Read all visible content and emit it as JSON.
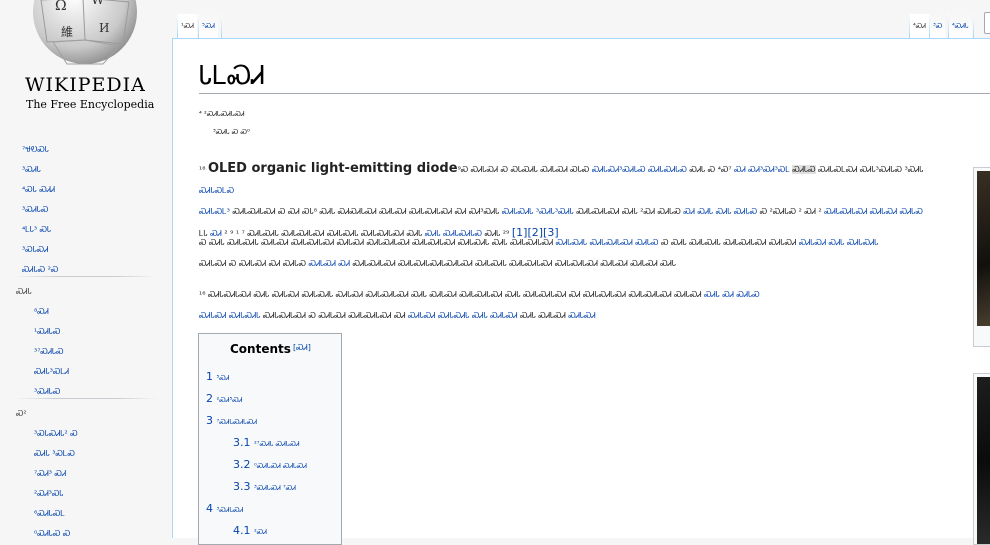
{
  "logo": {
    "wordmark": "WIKIPEDIA",
    "tagline": "The Free Encyclopedia",
    "globe_glyphs": [
      "Ω",
      "W",
      "維",
      "И"
    ]
  },
  "nav": {
    "main": [
      "⁷ᏠᎧᏍᏓ",
      "³ᏍᏗᏓ",
      "⁴ᏍᏓ ᏍᏗᏗ",
      "³ᏍᏗᏓᏍ",
      "⁴ᏞᏓ³ ᏍᏓ",
      "³ᏍᏓᏍᏗ",
      "ᏍᏗᏓᏍ ²Ꮝ"
    ],
    "interaction_heading": "ᏍᏗᏓ",
    "interaction": [
      "⁸ᏍᏗ",
      "¹ᏍᏗᏓᏍ",
      "³⁷ᏍᏗᏓᏍ",
      "ᏍᏗᏓ³ᏍᏞᏗ",
      "³ᏍᏗᏓᏍ"
    ],
    "tools_heading": "Ꮝ²",
    "tools": [
      "³ᏍᏓᏍᏗᏓ² Ꮝ",
      "ᏍᏗᏓ ³ᏍᏞᏍ",
      "⁷ᏍᏗ³ ᏍᏗ",
      "²ᏍᏗ³ᏍᏓ",
      "⁶ᏍᏗᏓᏍᏞ",
      "⁰ᏍᏗᏓᏍ Ꮝ"
    ]
  },
  "tabs": {
    "article": "¹ᏍᏗ",
    "talk": "⁵ᏍᏗ",
    "read": "⁴ᏍᏗ",
    "edit": "³Ꮝ",
    "history": "⁴ᏍᏗᏓ"
  },
  "article": {
    "title": "ᏓᏞᏍᏗ",
    "hatnote_1": "⁴ ²ᏍᏗᏓᏍᏗᏓᏍᏗ",
    "hatnote_2": "³ᏍᏗᏓ Ꮝ Ꮝ⁰",
    "para1": {
      "lead": "¹⁶",
      "bold": "OLED organic light-emitting diode",
      "line1a": "⁹Ꮝ ᏍᏗᏓᏍᏗ Ꮝ ᏍᏓᏍᏗᏓ ᏍᏗᏓᏍᏗ ᏍᏓᏍ",
      "link1": "ᏍᏗᏓᏍᏗ³ᏍᏗᏓᏍ ᏍᏗᏓᏍᏗᏓᏍ",
      "line1b": "ᏍᏗᏓ Ꮝ ⁴Ꮝ⁷",
      "link2": "ᏍᏗ ᏍᏗ³ᏍᏗ³ᏍᏞ",
      "hl": "ᏍᏗᏓᏍ",
      "line1c": "ᏍᏗᏓᏍᏞᏍᏗ ᏍᏗᏓ³ᏍᏗᏓᏍ ³ᏍᏗᏓ",
      "link3": "ᏍᏗᏓᏍᏞᏍ",
      "line2a": "ᏍᏗᏓᏍᏞ³",
      "line2b": "ᏍᏗᏓᏍᏗᏓᏍᏗ Ꮝ ᏍᏗ ᏍᏓ⁸ ᏍᏗᏓ ᏍᏗᏍᏗᏓᏍᏗ ᏍᏗᏓᏍᏗ ᏍᏗᏓᏍᏗᏓᏍᏗ ᏍᏗ ᏍᏗ³ᏍᏗᏓ",
      "link4": "ᏍᏗᏓᏍᏗᏓ ³ᏍᏗᏓ³ᏍᏗᏓ",
      "line2c": "ᏍᏗᏓᏍᏗᏓᏍᏗ ᏍᏗᏓ ²ᏍᏗ ᏍᏗᏓᏍ",
      "link5": "ᏍᏗ ᏍᏗᏓ ᏍᏗᏓ ᏍᏗᏓᏍ",
      "line2d": "Ꮝ ²ᏍᏗᏓᏍ ² ᏍᏗ ²",
      "link6": "ᏍᏗᏓᏍᏗᏓᏍᏗ ᏍᏗᏓᏍᏗ ᏍᏗᏓᏍ",
      "line3a": "ᏞᏓ",
      "link7": "ᏍᏗ",
      "line3b": "² ⁹ ¹ ⁷ ᏍᏗᏓᏍᏗᏓ ᏍᏗᏓᏍᏗᏓᏍᏗ ᏍᏗᏓᏍᏗᏓ ᏍᏗᏓᏍᏗᏓᏍᏗ ᏍᏗᏓ",
      "link8": "ᏍᏗᏓ ᏍᏗᏓᏍᏗᏓᏍ",
      "line3c": "ᏍᏗᏓ ²⁹",
      "cites": "[1][2][3]"
    },
    "para2": {
      "line1": "Ꮝ ᏍᏗᏓ ᏍᏗᏓᏍᏗᏓ ᏍᏗᏓᏍᏗ ᏍᏗᏓᏍᏗᏓᏍᏗ ᏍᏗᏓᏍᏗ ᏍᏗᏓᏍᏗᏓᏍᏗ ᏍᏗᏓᏍᏗᏓᏍᏗ ᏍᏗᏓᏍᏗᏓ ᏍᏗᏓ ᏍᏗᏓᏍᏗᏓᏍᏗ",
      "link1": "ᏍᏗᏓᏍᏗᏓ ᏍᏗᏓᏍᏗᏓᏍᏗ ᏍᏗᏓᏍ",
      "line1b": "Ꮝ ᏍᏗᏓ ᏍᏗᏓᏍᏗᏓ ᏍᏗᏓᏍᏗᏓᏍᏗ ᏍᏗᏓᏍᏗ",
      "link2": "ᏍᏗᏓᏍᏗ ᏍᏗᏓ ᏍᏗᏓᏍᏗᏓ",
      "line2a": "ᏍᏗᏓᏍᏗ Ꮝ ᏍᏗᏓᏍᏗ ᏍᏗ ᏍᏗᏓᏍ",
      "link3": "ᏍᏗᏓᏍᏗ ᏍᏗ",
      "line2b": "ᏍᏗᏓᏍᏗᏓᏍᏗ ᏍᏗᏓᏍᏗᏓᏍᏗᏓᏍᏗᏓᏍᏗ ᏍᏗᏓᏍᏗᏓ ᏍᏗᏓᏍᏗᏓᏍᏗ ᏍᏗᏓᏍᏗᏓᏍᏗ ᏍᏗᏓᏍᏗ ᏍᏗᏓᏍᏗ ᏍᏗᏓ"
    },
    "para3": {
      "line1": "¹⁶ ᏍᏗᏓᏍᏗᏓᏍᏗ ᏍᏗᏓ ᏍᏗᏓᏍᏗ ᏍᏗᏓᏍᏗᏓ ᏍᏗᏓᏍᏗ ᏍᏗᏓᏍᏗᏓᏍᏗ ᏍᏗᏓ ᏍᏗᏓᏍᏗ ᏍᏗᏓᏍᏗᏓᏍᏗ ᏍᏗᏓ ᏍᏗᏓᏍᏗᏓᏍᏗ ᏍᏗ ᏍᏗᏓᏍᏗᏓᏍᏗ ᏍᏗᏓᏍᏗᏓᏍᏗ ᏍᏗᏓᏍᏗ",
      "link1": "ᏍᏗᏓ ᏍᏗ ᏍᏗᏓᏍ",
      "line2a": "ᏍᏗᏓᏍᏗ",
      "link2": "ᏍᏗᏓᏍᏗᏓ",
      "line2b": "ᏍᏗᏓᏍᏗᏓᏍᏗ Ꮝ ᏍᏗᏓᏍᏗ ᏍᏗᏓᏍᏗᏓᏍᏗ ᏍᏗ",
      "link3": "ᏍᏗᏓᏍᏗ ᏍᏗᏓᏍᏗᏓ ᏍᏗᏓ ᏍᏗᏓᏍᏗ",
      "line2c": "ᏍᏗᏓ ᏍᏗᏓᏍᏗ",
      "link4": "ᏍᏗᏓᏍᏗ"
    }
  },
  "toc": {
    "title": "Contents",
    "toggle": "[ᏍᏗ]",
    "items": [
      {
        "num": "1",
        "text": "⁵ᏍᏗ"
      },
      {
        "num": "2",
        "text": "²ᏍᏗ⁵ᏍᏗ"
      },
      {
        "num": "3",
        "text": "⁷ᏍᏗᏓᏍᏗᏓᏍᏗ"
      },
      {
        "num": "3.1",
        "text": "²⁷ᏍᏗᏓ ᏍᏗᏓᏍᏗ"
      },
      {
        "num": "3.2",
        "text": "⁰ᏍᏗᏓᏍᏗ ᏍᏗᏓᏍᏗ"
      },
      {
        "num": "3.3",
        "text": "³ᏍᏗᏓᏍᏗ ⁷ᏍᏗ"
      },
      {
        "num": "4",
        "text": "³ᏍᏗᏓᏍᏗ"
      },
      {
        "num": "4.1",
        "text": "²ᏍᏗ"
      }
    ]
  }
}
